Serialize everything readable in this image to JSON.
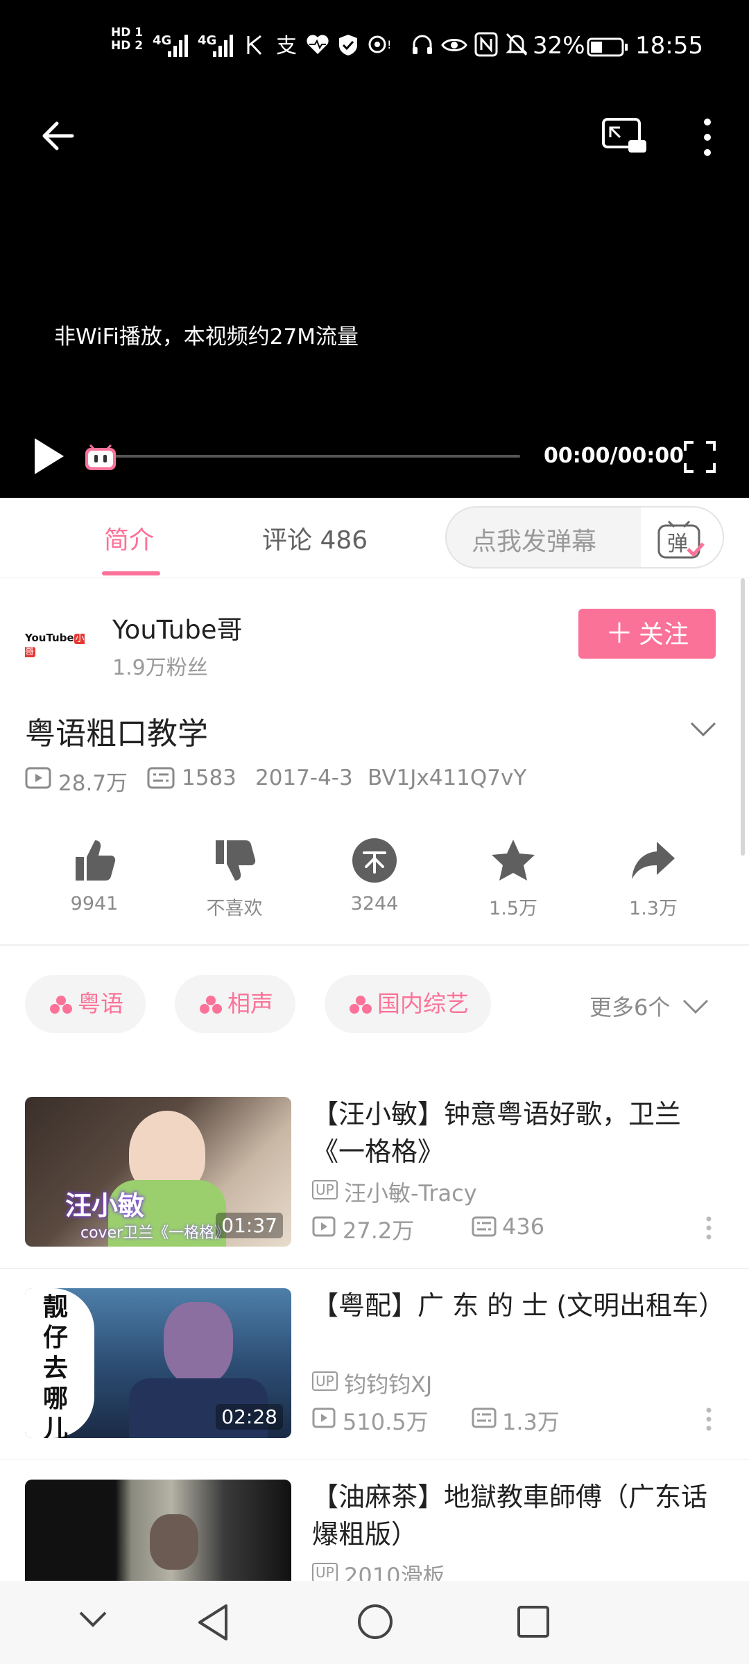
{
  "status_bar": {
    "hd1": "HD 1",
    "hd2": "HD 2",
    "signal1": "4G",
    "signal2": "4G",
    "battery": "32%",
    "time": "18:55"
  },
  "player": {
    "notice": "非WiFi播放，本视频约27M流量",
    "time": "00:00/00:00",
    "progress": 0
  },
  "tabs": {
    "intro": "简介",
    "comments": "评论 486",
    "danmu_placeholder": "点我发弹幕",
    "danmu_icon_char": "弹"
  },
  "uploader": {
    "name": "YouTube哥",
    "fans": "1.9万粉丝",
    "avatar_text": "YouTube",
    "avatar_badge": "小哥",
    "follow_label": "关注"
  },
  "video": {
    "title": "粤语粗口教学",
    "views": "28.7万",
    "danmaku": "1583",
    "date": "2017-4-3",
    "bvid": "BV1Jx411Q7vY"
  },
  "actions": {
    "like": "9941",
    "dislike": "不喜欢",
    "coin": "3244",
    "favorite": "1.5万",
    "share": "1.3万"
  },
  "tags": {
    "items": [
      "粤语",
      "相声",
      "国内综艺"
    ],
    "more": "更多6个"
  },
  "related": [
    {
      "title": "【汪小敏】钟意粤语好歌，卫兰《一格格》",
      "up": "汪小敏-Tracy",
      "views": "27.2万",
      "danmaku": "436",
      "duration": "01:37",
      "thumb_text": "汪小敏",
      "thumb_sub": "cover卫兰《一格格》"
    },
    {
      "title": "【粤配】广 东 的 士 (文明出租车）",
      "up": "钧钧钧XJ",
      "views": "510.5万",
      "danmaku": "1.3万",
      "duration": "02:28",
      "thumb_text": "靓仔去哪儿"
    },
    {
      "title": "【油麻茶】地獄教車師傅（广东话爆粗版）",
      "up": "2010滑板"
    }
  ],
  "up_badge": "UP",
  "colors": {
    "accent": "#fb7299",
    "icon_gray": "#5f5f5f",
    "text_gray": "#9a9a9a"
  }
}
